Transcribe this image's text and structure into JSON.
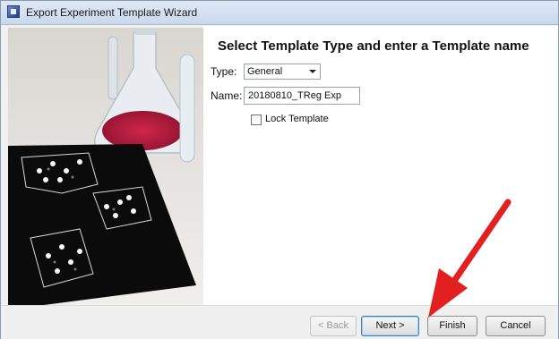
{
  "window": {
    "title": "Export Experiment Template Wizard"
  },
  "page": {
    "heading": "Select Template Type and enter a Template name",
    "type_label": "Type:",
    "type_value": "General",
    "name_label": "Name:",
    "name_value": "20180810_TReg Exp",
    "lock_label": "Lock Template",
    "lock_checked": false
  },
  "buttons": {
    "back": "< Back",
    "next": "Next >",
    "finish": "Finish",
    "cancel": "Cancel"
  },
  "colors": {
    "arrow": "#e32020",
    "title_bar": "#c8d8ec"
  },
  "icons": [
    "app-icon",
    "dropdown-arrow-icon",
    "red-arrow-annotation-icon"
  ]
}
